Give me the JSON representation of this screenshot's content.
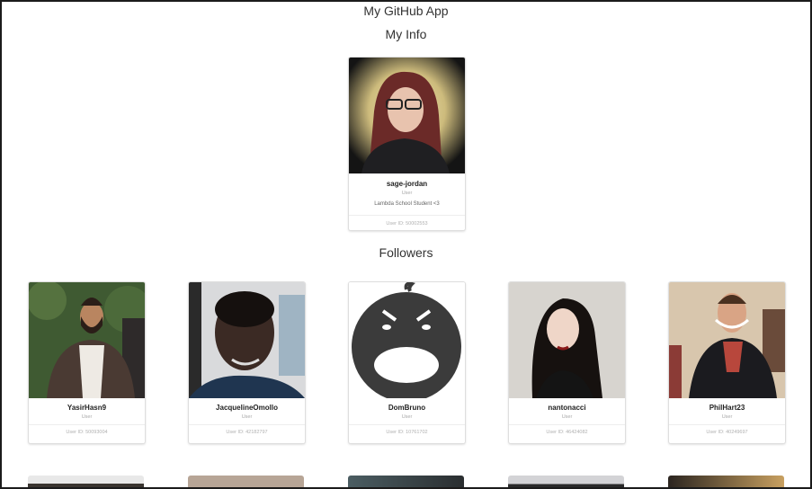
{
  "app": {
    "title": "My GitHub App"
  },
  "my_info": {
    "heading": "My Info",
    "user": {
      "login": "sage-jordan",
      "type": "User",
      "bio": "Lambda School Student <3",
      "user_id": "User ID: 50002553"
    }
  },
  "followers": {
    "heading": "Followers",
    "items": [
      {
        "login": "YasirHasn9",
        "type": "User",
        "user_id": "User ID: 50093004"
      },
      {
        "login": "JacquelineOmollo",
        "type": "User",
        "user_id": "User ID: 42182797"
      },
      {
        "login": "DomBruno",
        "type": "User",
        "user_id": "User ID: 10761702"
      },
      {
        "login": "nantonacci",
        "type": "User",
        "user_id": "User ID: 46424082"
      },
      {
        "login": "PhilHart23",
        "type": "User",
        "user_id": "User ID: 40249697"
      }
    ]
  }
}
